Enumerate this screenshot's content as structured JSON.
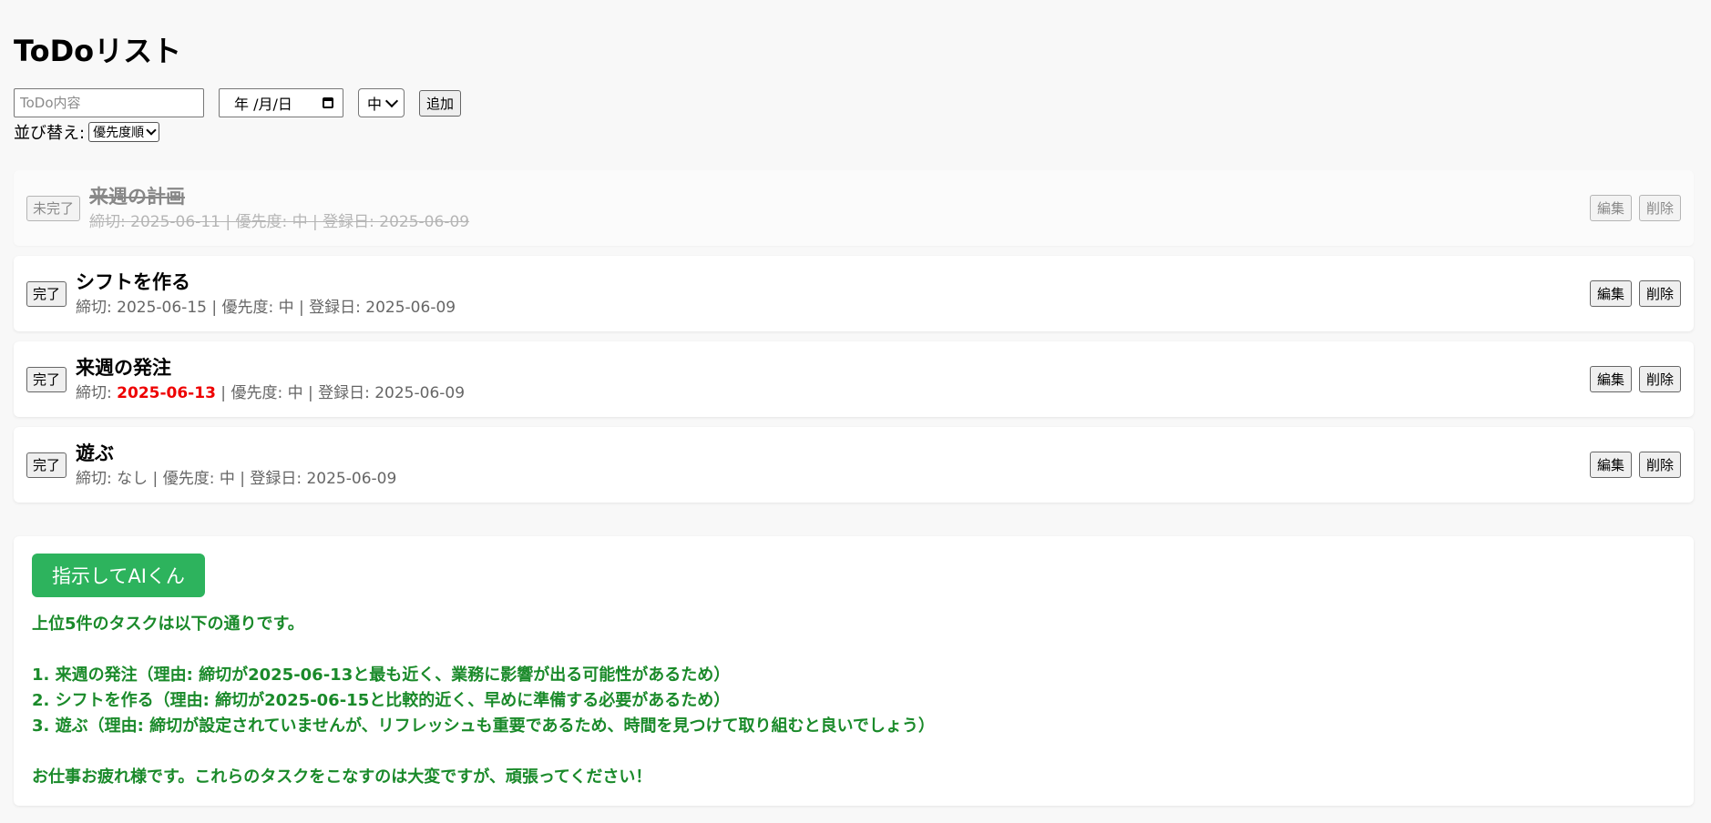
{
  "page_title": "ToDoリスト",
  "form": {
    "todo_placeholder": "ToDo内容",
    "date_placeholder": "年 /月/日",
    "priority_selected": "中",
    "add_label": "追加"
  },
  "sort": {
    "label": "並び替え:",
    "selected": "優先度順"
  },
  "todos": [
    {
      "title": "来週の計画",
      "toggle_label": "未完了",
      "deadline_prefix": "締切: ",
      "deadline": "2025-06-11",
      "rest": " | 優先度: 中 | 登録日: 2025-06-09",
      "edit_label": "編集",
      "delete_label": "削除",
      "completed": true
    },
    {
      "title": "シフトを作る",
      "toggle_label": "完了",
      "deadline_prefix": "締切: ",
      "deadline": "2025-06-15",
      "rest": " | 優先度: 中 | 登録日: 2025-06-09",
      "edit_label": "編集",
      "delete_label": "削除",
      "completed": false
    },
    {
      "title": "来週の発注",
      "toggle_label": "完了",
      "deadline_prefix": "締切: ",
      "deadline": "2025-06-13",
      "rest": " | 優先度: 中 | 登録日: 2025-06-09",
      "edit_label": "編集",
      "delete_label": "削除",
      "completed": false,
      "overdue": true
    },
    {
      "title": "遊ぶ",
      "toggle_label": "完了",
      "deadline_prefix": "締切: ",
      "deadline": "なし",
      "rest": " | 優先度: 中 | 登録日: 2025-06-09",
      "edit_label": "編集",
      "delete_label": "削除",
      "completed": false
    }
  ],
  "ai": {
    "button_label": "指示してAIくん",
    "response": "上位5件のタスクは以下の通りです。\n\n1. 来週の発注（理由: 締切が2025-06-13と最も近く、業務に影響が出る可能性があるため）\n2. シフトを作る（理由: 締切が2025-06-15と比較的近く、早めに準備する必要があるため）\n3. 遊ぶ（理由: 締切が設定されていませんが、リフレッシュも重要であるため、時間を見つけて取り組むと良いでしょう）\n\nお仕事お疲れ様です。これらのタスクをこなすのは大変ですが、頑張ってください！"
  },
  "colors": {
    "ai_button": "#2db35d",
    "ai_text": "#1a8a2a",
    "overdue": "#e00000"
  }
}
